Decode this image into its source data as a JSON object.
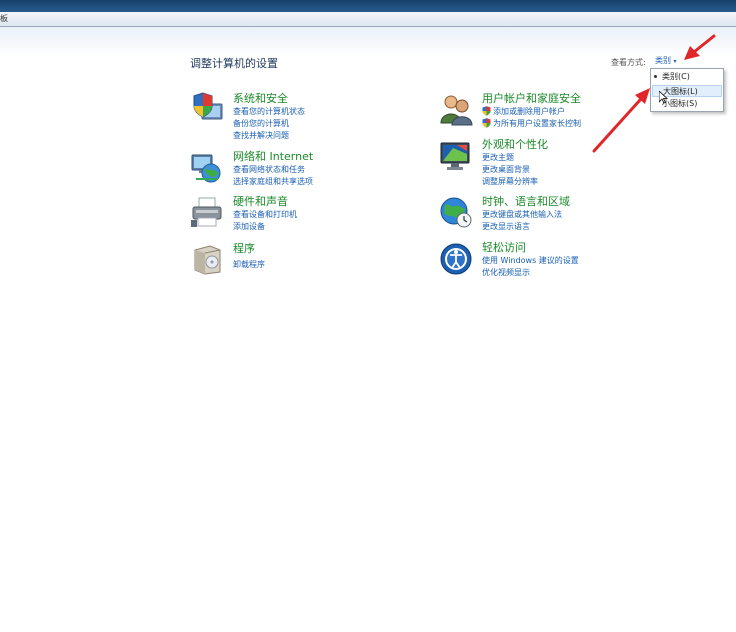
{
  "window": {
    "crumb": "板"
  },
  "page_title": "调整计算机的设置",
  "view": {
    "label": "查看方式:",
    "selected": "类别",
    "options": [
      "类别(C)",
      "大图标(L)",
      "小图标(S)"
    ]
  },
  "categories": [
    {
      "title": "系统和安全",
      "icon": "shield-computer-icon",
      "links": [
        "查看您的计算机状态",
        "备份您的计算机",
        "查找并解决问题"
      ]
    },
    {
      "title": "网络和 Internet",
      "icon": "network-globe-icon",
      "links": [
        "查看网络状态和任务",
        "选择家庭组和共享选项"
      ]
    },
    {
      "title": "硬件和声音",
      "icon": "printer-icon",
      "links": [
        "查看设备和打印机",
        "添加设备"
      ]
    },
    {
      "title": "程序",
      "icon": "program-box-icon",
      "links": [
        "卸载程序"
      ]
    },
    {
      "title": "用户帐户和家庭安全",
      "icon": "users-icon",
      "links": [
        "添加或删除用户帐户",
        "为所有用户设置家长控制"
      ]
    },
    {
      "title": "外观和个性化",
      "icon": "monitor-icon",
      "links": [
        "更改主题",
        "更改桌面背景",
        "调整屏幕分辨率"
      ]
    },
    {
      "title": "时钟、语言和区域",
      "icon": "globe-clock-icon",
      "links": [
        "更改键盘或其他输入法",
        "更改显示语言"
      ]
    },
    {
      "title": "轻松访问",
      "icon": "accessibility-icon",
      "links": [
        "使用 Windows 建议的设置",
        "优化视频显示"
      ]
    }
  ],
  "colors": {
    "accent_link": "#1a5fb4",
    "category_title": "#1b8a2a",
    "arrow": "#e0262a"
  }
}
